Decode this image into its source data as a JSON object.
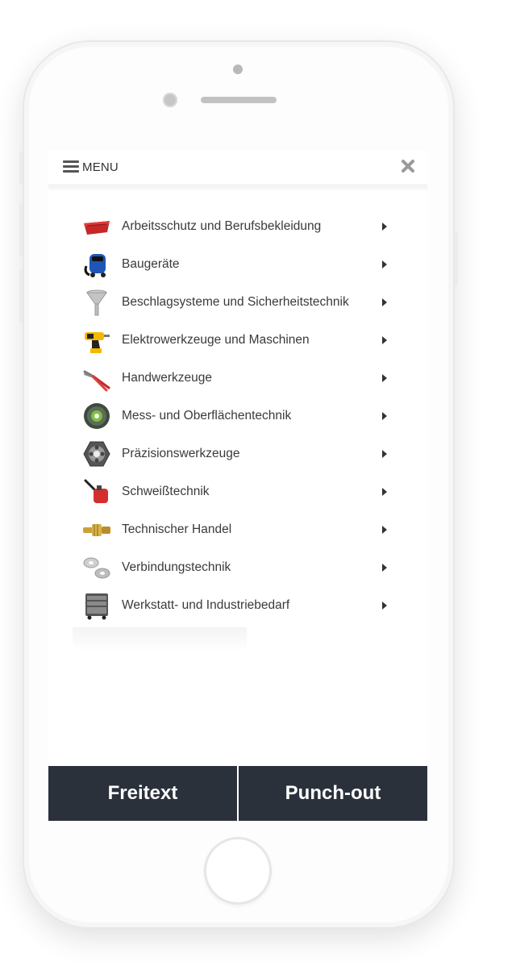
{
  "header": {
    "menu_label": "MENU",
    "menu_icon": "hamburger-icon",
    "close_icon": "close-icon"
  },
  "categories": [
    {
      "label": "Arbeitsschutz und Berufsbekleidung",
      "icon": "toolbox-tray-icon"
    },
    {
      "label": "Baugeräte",
      "icon": "vacuum-machine-icon"
    },
    {
      "label": "Beschlagsysteme und Sicherheitstechnik",
      "icon": "funnel-icon"
    },
    {
      "label": "Elektrowerkzeuge und Maschinen",
      "icon": "drill-icon"
    },
    {
      "label": "Handwerkzeuge",
      "icon": "pliers-icon"
    },
    {
      "label": "Mess- und Oberflächentechnik",
      "icon": "grinding-disc-icon"
    },
    {
      "label": "Präzisionswerkzeuge",
      "icon": "die-nut-icon"
    },
    {
      "label": "Schweißtechnik",
      "icon": "welding-torch-icon"
    },
    {
      "label": "Technischer Handel",
      "icon": "hose-coupling-icon"
    },
    {
      "label": "Verbindungstechnik",
      "icon": "washer-icon"
    },
    {
      "label": "Werkstatt- und Industriebedarf",
      "icon": "tool-cart-icon"
    }
  ],
  "footer": {
    "left_button": "Freitext",
    "right_button": "Punch-out"
  },
  "colors": {
    "footer_bg": "#2b313b",
    "text": "#3a3a3a",
    "accent_red": "#d32f2f",
    "accent_blue": "#1f56b5"
  }
}
